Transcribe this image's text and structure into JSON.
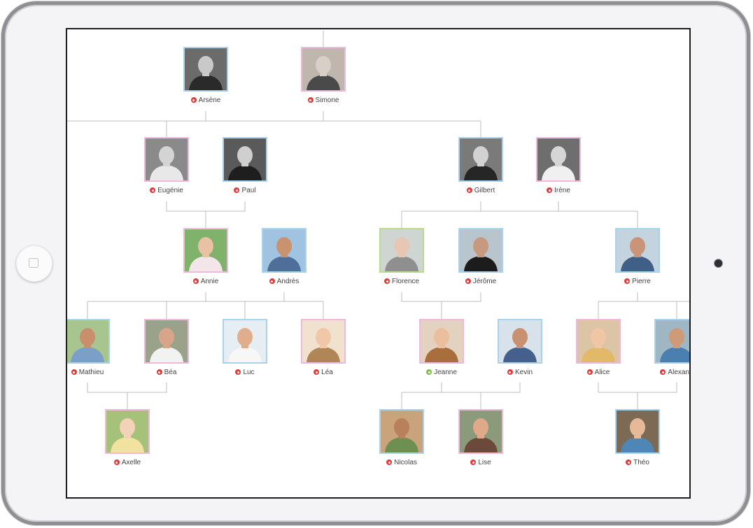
{
  "colors": {
    "male_border": "#a9d2ec",
    "female_border": "#efb9df",
    "selected_border": "#b7dd8c",
    "deceased_dot": "#e23a3a",
    "living_dot": "#7bbf45",
    "connector_line": "#bdbdbd"
  },
  "people": [
    {
      "name": "Arsène",
      "gender": "male",
      "status": "deceased",
      "photo": "vintage"
    },
    {
      "name": "Simone",
      "gender": "female",
      "status": "deceased",
      "photo": "vintage"
    },
    {
      "name": "Eugénie",
      "gender": "female",
      "status": "deceased",
      "photo": "vintage"
    },
    {
      "name": "Paul",
      "gender": "male",
      "status": "deceased",
      "photo": "vintage"
    },
    {
      "name": "Gilbert",
      "gender": "male",
      "status": "deceased",
      "photo": "vintage"
    },
    {
      "name": "Irène",
      "gender": "female",
      "status": "deceased",
      "photo": "vintage"
    },
    {
      "name": "Annie",
      "gender": "female",
      "status": "deceased",
      "photo": "color"
    },
    {
      "name": "Andrès",
      "gender": "male",
      "status": "deceased",
      "photo": "color"
    },
    {
      "name": "Florence",
      "gender": "female",
      "status": "deceased",
      "photo": "color",
      "selected": true
    },
    {
      "name": "Jérôme",
      "gender": "male",
      "status": "deceased",
      "photo": "color"
    },
    {
      "name": "Pierre",
      "gender": "male",
      "status": "deceased",
      "photo": "color"
    },
    {
      "name": "Mathieu",
      "gender": "male",
      "status": "deceased",
      "photo": "color"
    },
    {
      "name": "Béa",
      "gender": "female",
      "status": "deceased",
      "photo": "color"
    },
    {
      "name": "Luc",
      "gender": "male",
      "status": "deceased",
      "photo": "color"
    },
    {
      "name": "Léa",
      "gender": "female",
      "status": "deceased",
      "photo": "color"
    },
    {
      "name": "Jeanne",
      "gender": "female",
      "status": "living",
      "photo": "color"
    },
    {
      "name": "Kevin",
      "gender": "male",
      "status": "deceased",
      "photo": "color"
    },
    {
      "name": "Alice",
      "gender": "female",
      "status": "deceased",
      "photo": "color"
    },
    {
      "name": "Alexand",
      "gender": "male",
      "status": "deceased",
      "photo": "color"
    },
    {
      "name": "Axelle",
      "gender": "female",
      "status": "deceased",
      "photo": "color"
    },
    {
      "name": "Nicolas",
      "gender": "male",
      "status": "deceased",
      "photo": "color"
    },
    {
      "name": "Lise",
      "gender": "female",
      "status": "deceased",
      "photo": "color"
    },
    {
      "name": "Théo",
      "gender": "male",
      "status": "deceased",
      "photo": "color"
    }
  ]
}
